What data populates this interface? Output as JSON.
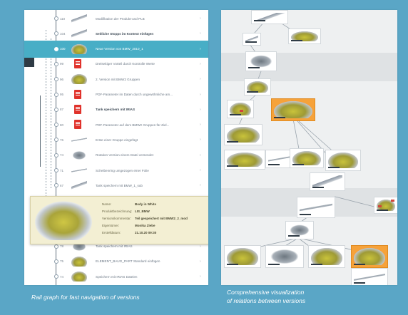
{
  "captions": {
    "left": "Rail graph for fast navigation of versions",
    "right_line1": "Comprehensive visualization",
    "right_line2": "of relations between versions"
  },
  "rows": [
    {
      "num": "110",
      "label": "Modifikation der Produkt-und PLB",
      "thumb": "part",
      "bold": false,
      "sel": false
    },
    {
      "num": "104",
      "label": "Seitliche Stopps im Kontext einfügen",
      "thumb": "part",
      "bold": true,
      "sel": false
    },
    {
      "num": "100",
      "label": "Neue Version von BMW_2010_1",
      "thumb": "car",
      "bold": false,
      "sel": true
    },
    {
      "num": "99",
      "label": "Dreiseitiger Vorteil durch Kontrolle Werte",
      "thumb": "pdf",
      "bold": false,
      "sel": false
    },
    {
      "num": "96",
      "label": "2. Version mit BMW2 Gruppen",
      "thumb": "car",
      "bold": false,
      "sel": false
    },
    {
      "num": "95",
      "label": "PDF-Parameter im Daten durch ungewöhnliche am...",
      "thumb": "pdf",
      "bold": false,
      "sel": false
    },
    {
      "num": "87",
      "label": "Tank speichern mit IRIAS",
      "thumb": "pdf",
      "bold": true,
      "sel": false
    },
    {
      "num": "80",
      "label": "PDF-Parameter auf dem BMW2 Gruppen für Ziel...",
      "thumb": "pdf",
      "bold": false,
      "sel": false
    },
    {
      "num": "76",
      "label": "Erste einer Gruppe eingefügt",
      "thumb": "line",
      "bold": false,
      "sel": false
    },
    {
      "num": "74",
      "label": "Rotation Version einem Datei versendet",
      "thumb": "part2",
      "bold": false,
      "sel": false
    },
    {
      "num": "71",
      "label": "Scheibenring umgezogen einer Folie",
      "thumb": "line",
      "bold": false,
      "sel": false
    },
    {
      "num": "67",
      "label": "Tank speichern mit BMW_1_sub",
      "thumb": "part",
      "bold": false,
      "sel": false
    },
    {
      "num": "66",
      "label": "",
      "thumb": "",
      "bold": false,
      "sel": false
    },
    {
      "num": "",
      "label": "",
      "thumb": "",
      "bold": false,
      "sel": false
    },
    {
      "num": "",
      "label": "",
      "thumb": "",
      "bold": false,
      "sel": false
    },
    {
      "num": "78",
      "label": "Tank speichern mit IRIAS",
      "thumb": "part2",
      "bold": false,
      "sel": false
    },
    {
      "num": "75",
      "label": "ELEMENT_BAUG_PART Standard einfügen",
      "thumb": "car",
      "bold": false,
      "sel": false
    },
    {
      "num": "74",
      "label": "Speichern mit IRIAS Dateien",
      "thumb": "car",
      "bold": false,
      "sel": false
    }
  ],
  "popup": {
    "items": [
      {
        "key": "Name:",
        "value": "Body in White"
      },
      {
        "key": "Produktbezeichnung:",
        "value": "LIS_BMW"
      },
      {
        "key": "Versionskommentar:",
        "value": "Teil gespeichert mit BMW2_2_mod"
      },
      {
        "key": "Eigentümer:",
        "value": "Monika Ziebe"
      },
      {
        "key": "Erstelldatum:",
        "value": "21.10.20 09:30"
      }
    ]
  },
  "graph": {
    "accent": "#f6a23a"
  }
}
